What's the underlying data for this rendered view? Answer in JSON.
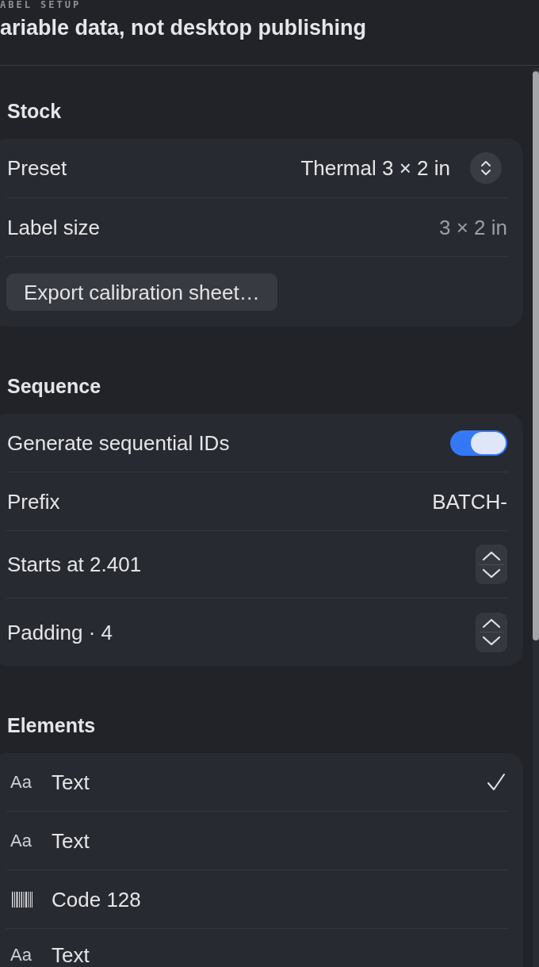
{
  "header": {
    "eyebrow": "ABEL SETUP",
    "title": "ariable data, not desktop publishing"
  },
  "sections": [
    {
      "title": "Stock",
      "rows": [
        {
          "kind": "select",
          "label": "Preset",
          "value": "Thermal 3 × 2 in"
        },
        {
          "kind": "value",
          "label": "Label size",
          "value": "3 × 2 in"
        },
        {
          "kind": "button",
          "label": "Export calibration sheet…"
        }
      ]
    },
    {
      "title": "Sequence",
      "rows": [
        {
          "kind": "toggle",
          "label": "Generate sequential IDs",
          "on": true
        },
        {
          "kind": "field",
          "label": "Prefix",
          "value": "BATCH-"
        },
        {
          "kind": "stepper",
          "label": "Starts at 2.401"
        },
        {
          "kind": "stepper",
          "label": "Padding · 4"
        }
      ]
    },
    {
      "title": "Elements",
      "rows": [
        {
          "kind": "text",
          "glyph": "Aa",
          "label": "Text",
          "selected": true
        },
        {
          "kind": "text",
          "glyph": "Aa",
          "label": "Text",
          "selected": false
        },
        {
          "kind": "barcode",
          "label": "Code 128",
          "selected": false
        },
        {
          "kind": "text",
          "glyph": "Aa",
          "label": "Text",
          "selected": false
        }
      ]
    }
  ]
}
